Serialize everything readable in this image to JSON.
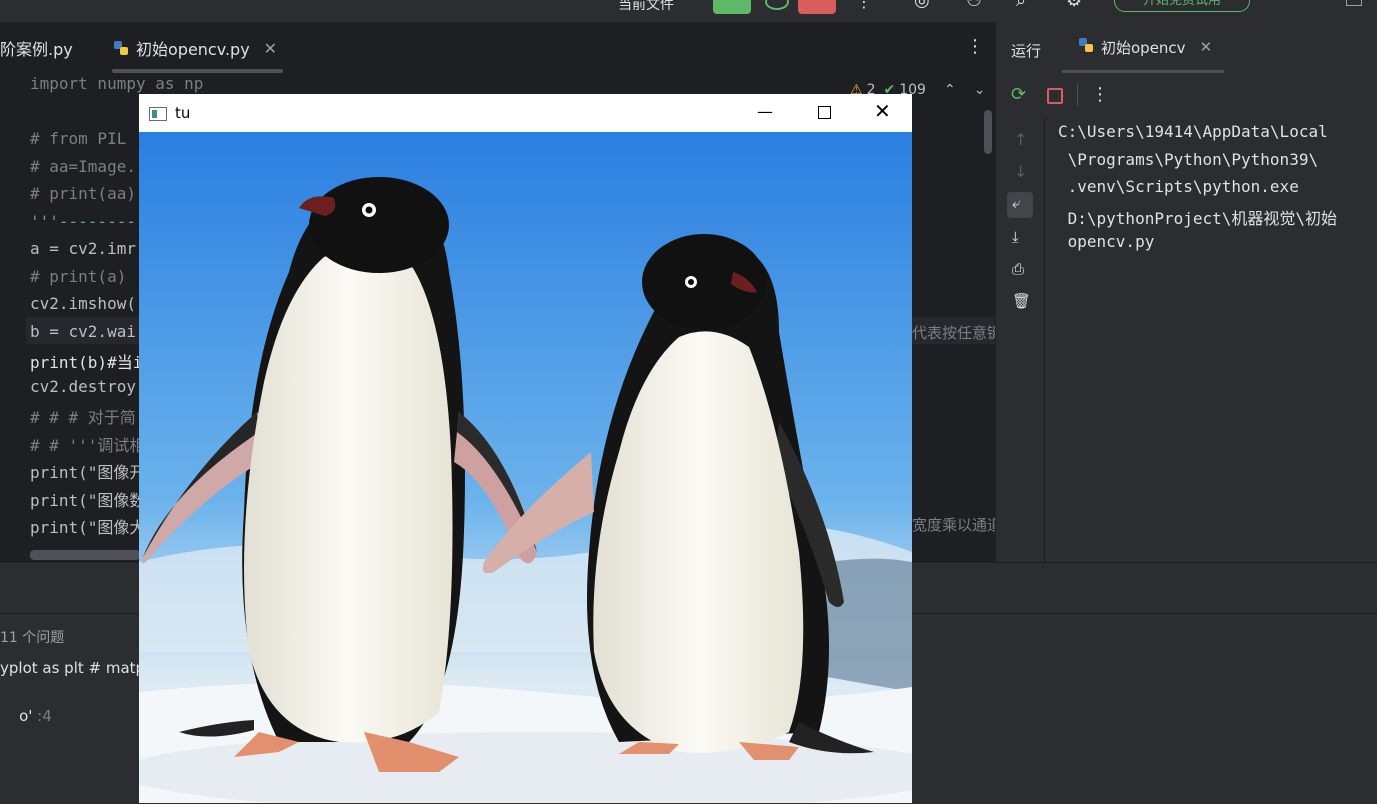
{
  "topbar": {
    "current_file_label": "当前文件",
    "upgrade_label": "开始免费试用"
  },
  "editor_tabs": [
    {
      "label": "阶案例.py"
    },
    {
      "label": "初始opencv.py"
    }
  ],
  "inspection": {
    "warnings": "2",
    "ok": "109"
  },
  "code_lines": [
    {
      "text": "import numpy as np",
      "cls": "cm"
    },
    {
      "text": "",
      "cls": ""
    },
    {
      "text": "# from PIL",
      "cls": "cm"
    },
    {
      "text": "# aa=Image.",
      "cls": "cm"
    },
    {
      "text": "# print(aa)",
      "cls": "cm"
    },
    {
      "text": "'''--------",
      "cls": "str"
    },
    {
      "text": "a = cv2.imr",
      "cls": ""
    },
    {
      "text": "# print(a)",
      "cls": "cm"
    },
    {
      "text": "cv2.imshow(",
      "cls": ""
    },
    {
      "text": "b = cv2.wai",
      "cls": ""
    },
    {
      "text": "print(b)#当i",
      "cls": ""
    },
    {
      "text": "cv2.destroy",
      "cls": ""
    },
    {
      "text": "# # # 对于简",
      "cls": "cm"
    },
    {
      "text": "# # '''调试相",
      "cls": "cm"
    },
    {
      "text": "print(\"图像开",
      "cls": ""
    },
    {
      "text": "print(\"图像数",
      "cls": ""
    },
    {
      "text": "print(\"图像大",
      "cls": ""
    }
  ],
  "code_tails": {
    "line10": "代表按任意键",
    "line17": "宽度乘以通道"
  },
  "run_panel": {
    "title": "运行",
    "tab_label": "初始opencv",
    "output_lines": [
      "C:\\Users\\19414\\AppData\\Local",
      " \\Programs\\Python\\Python39\\",
      " .venv\\Scripts\\python.exe",
      " D:\\pythonProject\\机器视觉\\初始",
      " opencv.py"
    ]
  },
  "bottom_panel": {
    "problems_label": "11 个问题",
    "line1": "yplot as plt # matp",
    "line2_name": "o'",
    "line2_num": " :4"
  },
  "cv_window": {
    "title": "tu"
  },
  "colors": {
    "accent_blue": "#3574f0",
    "run_green": "#5fb865",
    "stop_red": "#db5c5c"
  }
}
